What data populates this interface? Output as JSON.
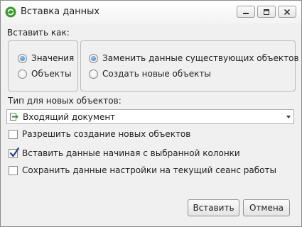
{
  "window": {
    "title": "Вставка данных",
    "accent_color": "#3a9b2c",
    "controls": [
      "minimize-icon",
      "maximize-icon",
      "close-icon"
    ]
  },
  "paste_as": {
    "label": "Вставить как:",
    "mode_options": [
      {
        "label": "Значения",
        "checked": true
      },
      {
        "label": "Объекты",
        "checked": false
      }
    ],
    "target_options": [
      {
        "label": "Заменить данные существующих объектов",
        "checked": true
      },
      {
        "label": "Создать новые объекты",
        "checked": false
      }
    ]
  },
  "object_type": {
    "label": "Тип для новых объектов:",
    "selected": "Входящий документ",
    "icon": "incoming-document-icon"
  },
  "checkboxes": [
    {
      "label": "Разрешить создание новых объектов",
      "checked": false
    },
    {
      "label": "Вставить данные начиная с выбранной колонки",
      "checked": true
    },
    {
      "label": "Сохранить данные настройки на текущий сеанс работы",
      "checked": false
    }
  ],
  "buttons": {
    "paste": "Вставить",
    "cancel": "Отмена"
  }
}
